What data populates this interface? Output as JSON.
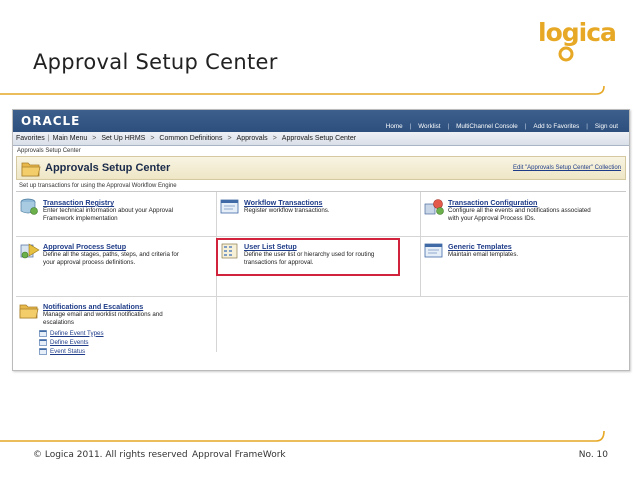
{
  "slide": {
    "title": "Approval Setup Center",
    "logo_text": "logica",
    "footer_copyright": "© Logica 2011. All rights reserved",
    "footer_center": "Approval FrameWork",
    "footer_page": "No. 10"
  },
  "oracle": {
    "brand": "ORACLE",
    "top_links": [
      "Home",
      "Worklist",
      "MultiChannel Console",
      "Add to Favorites",
      "Sign out"
    ]
  },
  "nav": {
    "items": [
      "Favorites",
      "Main Menu",
      "Set Up HRMS",
      "Common Definitions",
      "Approvals",
      "Approvals Setup Center"
    ]
  },
  "page": {
    "breadcrumb": "Approvals Setup Center",
    "heading": "Approvals Setup Center",
    "edit_collection": "Edit \"Approvals Setup Center\" Collection",
    "subtitle": "Set up transactions for using the Approval Workflow Engine"
  },
  "tiles": {
    "transaction_registry": {
      "title": "Transaction Registry",
      "desc1": "Enter technical information about your Approval",
      "desc2": "Framework implementation"
    },
    "workflow_transactions": {
      "title": "Workflow Transactions",
      "desc1": "Register workflow transactions."
    },
    "transaction_configuration": {
      "title": "Transaction Configuration",
      "desc1": "Configure all the events and notifications associated",
      "desc2": "with your Approval Process IDs."
    },
    "approval_process_setup": {
      "title": "Approval Process Setup",
      "desc1": "Define all the stages, paths, steps, and criteria for",
      "desc2": "your approval process definitions."
    },
    "user_list_setup": {
      "title": "User List Setup",
      "desc1": "Define the user list or hierarchy used for routing",
      "desc2": "transactions for approval."
    },
    "generic_templates": {
      "title": "Generic Templates",
      "desc1": "Maintain email templates."
    },
    "notifications": {
      "title": "Notifications and Escalations",
      "desc1": "Manage email and worklist notifications and",
      "desc2": "escalations",
      "links": [
        "Define Event Types",
        "Define Events",
        "Event Status"
      ]
    }
  },
  "colors": {
    "oracle_bar": "#2c4f7e",
    "link": "#1f3c88",
    "highlight": "#d2233c",
    "logo": "#e6a825"
  }
}
